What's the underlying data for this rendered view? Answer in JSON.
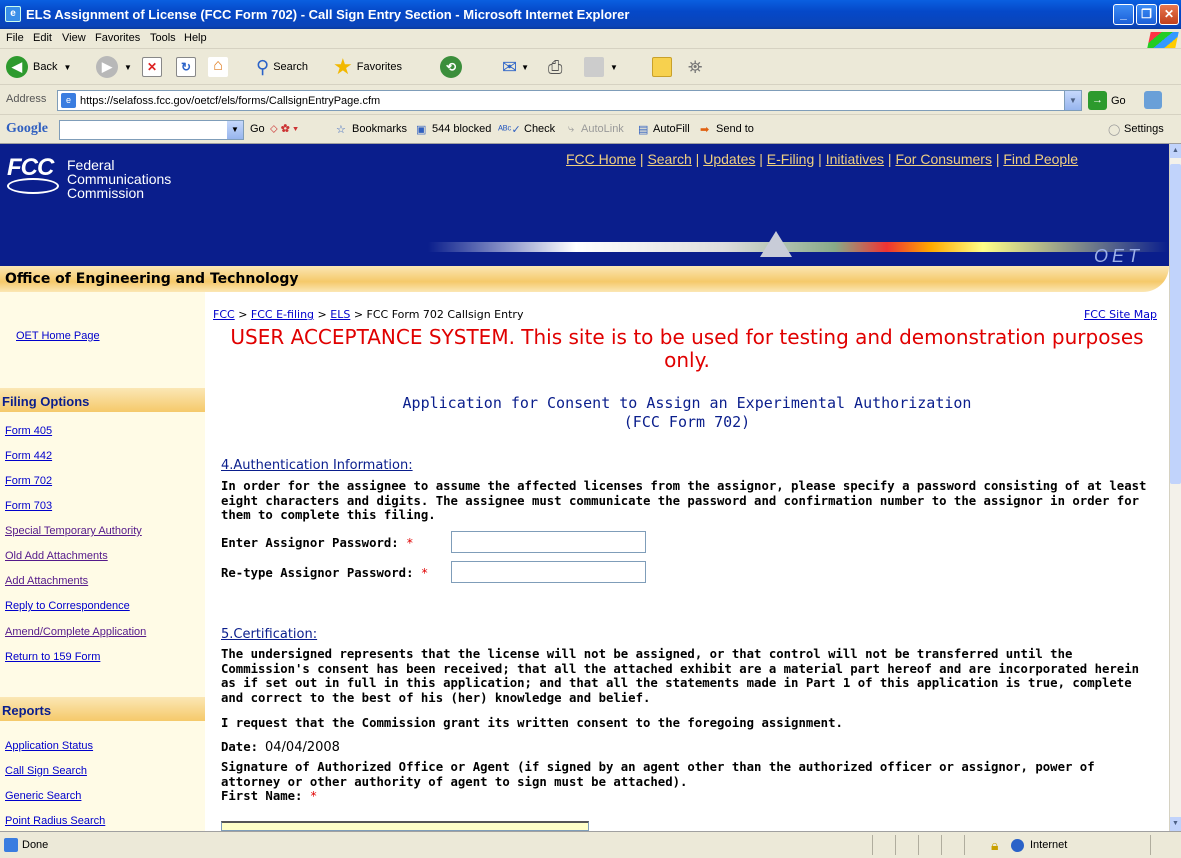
{
  "window": {
    "title": "ELS Assignment of License (FCC Form 702) - Call Sign Entry Section - Microsoft Internet Explorer"
  },
  "menu": [
    "File",
    "Edit",
    "View",
    "Favorites",
    "Tools",
    "Help"
  ],
  "toolbar": {
    "back": "Back",
    "search": "Search",
    "favorites": "Favorites"
  },
  "address": {
    "label": "Address",
    "url": "https://selafoss.fcc.gov/oetcf/els/forms/CallsignEntryPage.cfm",
    "go": "Go"
  },
  "google_bar": {
    "logo": "Google",
    "go": "Go",
    "bookmarks": "Bookmarks",
    "blocked": "544 blocked",
    "check": "Check",
    "autolink": "AutoLink",
    "autofill": "AutoFill",
    "sendto": "Send to",
    "settings": "Settings"
  },
  "header": {
    "logo_text": "FCC",
    "agency_line1": "Federal",
    "agency_line2": "Communications",
    "agency_line3": "Commission",
    "nav": [
      "FCC Home",
      "Search",
      "Updates",
      "E-Filing",
      "Initiatives",
      "For Consumers",
      "Find People"
    ],
    "oet_mark": "OET",
    "office": "Office of Engineering and Technology"
  },
  "sidebar": {
    "home": "OET Home Page",
    "filing_head": "Filing Options",
    "filing": [
      "Form 405",
      "Form 442",
      "Form 702",
      "Form 703",
      "Special Temporary Authority",
      "Old Add Attachments",
      "Add Attachments",
      "Reply to Correspondence",
      "Amend/Complete Application",
      "Return to 159 Form"
    ],
    "reports_head": "Reports",
    "reports": [
      "Application Status",
      "Call Sign Search",
      "Generic Search",
      "Point Radius Search"
    ]
  },
  "breadcrumb": {
    "fcc": "FCC",
    "efiling": "FCC E-filing",
    "els": "ELS",
    "current": "FCC Form 702 Callsign Entry",
    "sep": ">",
    "sitemap": "FCC Site Map"
  },
  "notice": "USER ACCEPTANCE SYSTEM. This site is to be used for testing and demonstration purposes only.",
  "form_title": {
    "line1": "Application for Consent to Assign an Experimental Authorization",
    "line2": "(FCC Form 702)"
  },
  "auth": {
    "heading": "4.Authentication Information:",
    "text": "In order for the assignee to assume the affected licenses from the assignor, please specify a password consisting of at least eight characters and digits. The assignee must communicate the password and confirmation number to the assignor in order for them to complete this filing.",
    "pw_label": "Enter Assignor Password:",
    "pw2_label": "Re-type Assignor Password:",
    "pw_value": "",
    "pw2_value": "",
    "required": "*"
  },
  "cert": {
    "heading": "5.Certification:",
    "text": "The undersigned represents that the license will not be assigned, or that control will not be transferred until the Commission's consent has been received; that all the attached exhibit are a material part hereof and are incorporated herein as if set out in full in this application; and that all the statements made in Part 1 of this application is true, complete and correct to the best of his (her) knowledge and belief.",
    "request": "I request that the Commission grant its written consent to the foregoing assignment.",
    "date_label": "Date:",
    "date_value": "04/04/2008",
    "signature": "Signature of Authorized Office or Agent (if signed by an agent other than the authorized officer or assignor, power of attorney or other authority of agent to sign must be attached).",
    "first_name_label": "First Name:",
    "first_name_value": ""
  },
  "status": {
    "text": "Done",
    "zone": "Internet"
  }
}
